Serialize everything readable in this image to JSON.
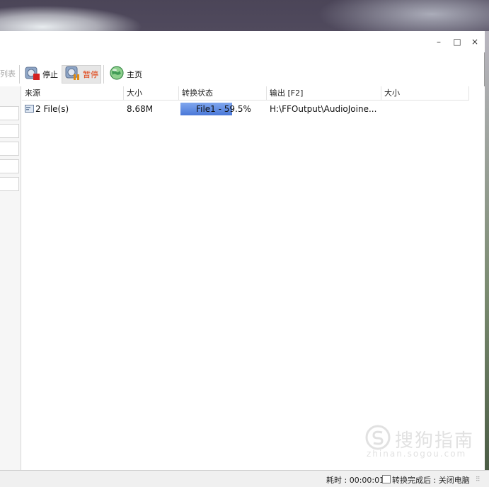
{
  "window": {
    "controls": {
      "minimize": "–",
      "maximize": "□",
      "close": "×"
    }
  },
  "toolbar": {
    "cut_label": "列表",
    "stop_label": "停止",
    "pause_label": "暂停",
    "home_label": "主页"
  },
  "table": {
    "headers": [
      "来源",
      "大小",
      "转换状态",
      "输出 [F2]",
      "大小"
    ],
    "rows": [
      {
        "source": "2 File(s)",
        "size": "8.68M",
        "status": "File1 - 59.5%",
        "progress": 0.595,
        "output": "H:\\FFOutput\\AudioJoine...",
        "out_size": ""
      }
    ]
  },
  "statusbar": {
    "elapsed": "耗时 : 00:00:01",
    "after_done": "转换完成后 : 关闭电脑"
  },
  "watermark": {
    "text": "搜狗指南",
    "sub": "zhinan.sogou.com"
  },
  "colors": {
    "progress_fill": "#4a78d8",
    "pause_text": "#e04010"
  }
}
